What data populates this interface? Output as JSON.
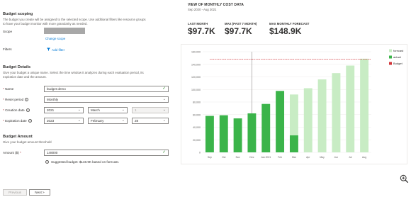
{
  "left": {
    "scoping": {
      "heading": "Budget scoping",
      "description_lines": [
        "The budget you create will be assigned to the selected scope. Use additional filters like resource groups",
        "to have your budget monitor with more granularity as needed."
      ],
      "scope_label": "Scope",
      "change_scope_link": "Change scope",
      "filters_label": "Filters",
      "add_filter_label": "Add filter"
    },
    "details": {
      "heading": "Budget Details",
      "description_lines": [
        "Give your budget a unique name. Select the time window it analyzes during each evaluation period, its",
        "expiration date and the amount."
      ],
      "name_label": "Name",
      "name_value": "budget demo",
      "reset_label": "Reset period",
      "reset_value": "Monthly",
      "creation_label": "Creation date",
      "creation_year": "2021",
      "creation_month": "March",
      "creation_day": "1",
      "expiration_label": "Expiration date",
      "expiration_year": "2023",
      "expiration_month": "February",
      "expiration_day": "28"
    },
    "amount": {
      "heading": "Budget Amount",
      "description": "Give your budget amount threshold",
      "amount_label": "Amount ($)",
      "amount_value": "148000",
      "suggestion": "Suggested budget: $148.9K based on forecast."
    },
    "nav": {
      "previous_label": "Previous",
      "next_label": "Next >"
    },
    "required_mark": "*",
    "info_glyph": "i",
    "check_glyph": "✓",
    "chevron_glyph": "⌄"
  },
  "right": {
    "title": "VIEW OF MONTHLY COST DATA",
    "subtitle": "Sep 2020 - Aug 2021",
    "kpis": [
      {
        "label": "LAST MONTH",
        "value": "$97.7K"
      },
      {
        "label": "MAX (PAST 7 MONTH)",
        "value": "$97.7K"
      },
      {
        "label": "MAX MONTHLY FORECAST",
        "value": "$148.9K"
      }
    ]
  },
  "icons": {
    "zoom": "zoom-in-icon",
    "funnel": "funnel-icon"
  },
  "colors": {
    "actual": "#3bb44a",
    "forecast": "#c8ecc4",
    "budget": "#d13438",
    "link": "#0078d4",
    "valid": "#107c10"
  },
  "chart_data": {
    "type": "bar",
    "categories": [
      "Sep",
      "Oct",
      "Nov",
      "Dec",
      "Jan 2021",
      "Feb",
      "Mar",
      "Apr",
      "May",
      "Jun",
      "Jul",
      "Aug"
    ],
    "series": [
      {
        "name": "forecast",
        "values": [
          null,
          null,
          null,
          null,
          null,
          null,
          92000,
          102000,
          116000,
          126000,
          138000,
          148900
        ]
      },
      {
        "name": "actual",
        "values": [
          58000,
          59000,
          54000,
          62000,
          77000,
          97700,
          27000,
          null,
          null,
          null,
          null,
          null
        ]
      },
      {
        "name": "Budget",
        "values": [
          148000,
          148000,
          148000,
          148000,
          148000,
          148000,
          148000,
          148000,
          148000,
          148000,
          148000,
          148000
        ]
      }
    ],
    "ylim": [
      0,
      160000
    ],
    "yticks": [
      0,
      20000,
      40000,
      60000,
      80000,
      100000,
      120000,
      140000,
      160000
    ],
    "ytick_labels": [
      "0",
      "20,000",
      "40,000",
      "60,000",
      "80,000",
      "100,000",
      "120,000",
      "140,000",
      "160,000"
    ],
    "grid": true,
    "legend": "right",
    "marker_category": "Dec"
  }
}
